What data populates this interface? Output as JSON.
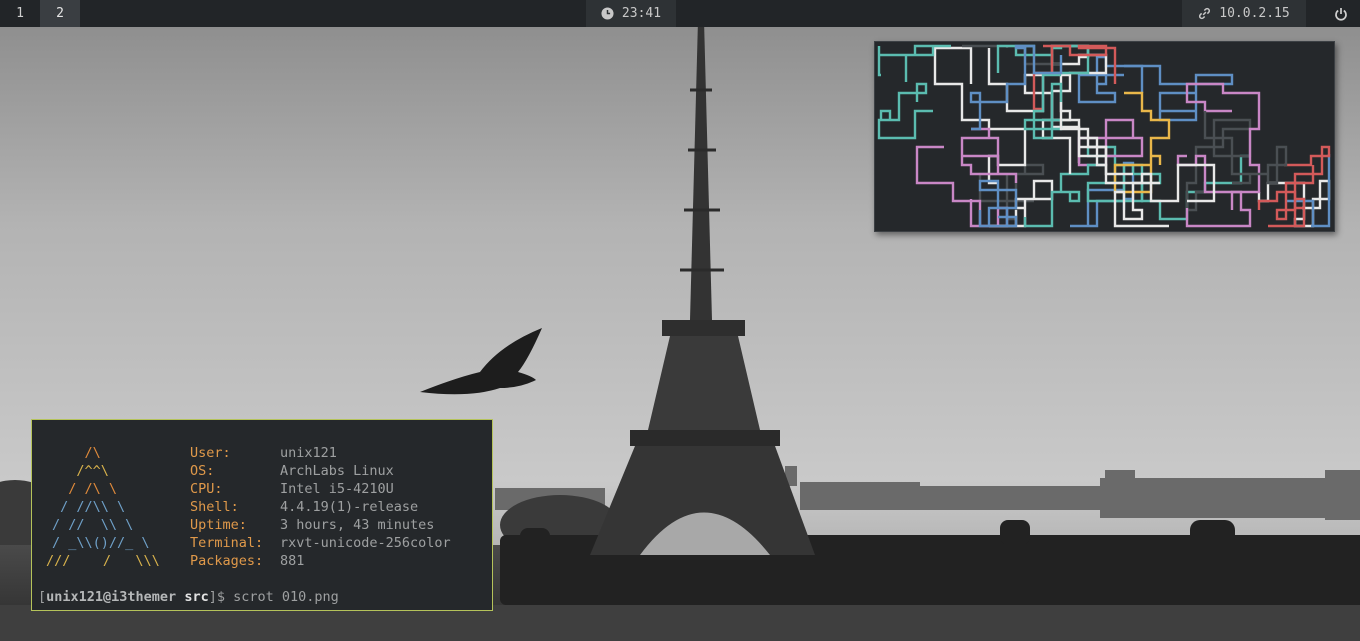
{
  "topbar": {
    "workspaces": [
      {
        "label": "1",
        "active": false
      },
      {
        "label": "2",
        "active": true
      }
    ],
    "clock": {
      "icon": "clock-icon",
      "time": "23:41"
    },
    "network": {
      "icon": "link-icon",
      "ip": "10.0.2.15"
    },
    "power": {
      "icon": "power-icon"
    }
  },
  "terminal": {
    "logo_lines": [
      "    /\\",
      "   /^^\\",
      "  / /\\ \\",
      " / //\\\\ \\",
      "/ //  \\\\ \\",
      "/ _\\\\()//_ \\",
      "///    /   \\\\\\"
    ],
    "info": [
      {
        "key": "User:",
        "value": "unix121"
      },
      {
        "key": "OS:",
        "value": "ArchLabs Linux"
      },
      {
        "key": "CPU:",
        "value": "Intel i5-4210U"
      },
      {
        "key": "Shell:",
        "value": "4.4.19(1)-release"
      },
      {
        "key": "Uptime:",
        "value": "3 hours, 43 minutes"
      },
      {
        "key": "Terminal:",
        "value": "rxvt-unicode-256color"
      },
      {
        "key": "Packages:",
        "value": "881"
      }
    ],
    "prompt": {
      "open": "[",
      "user_host": "unix121@i3themer",
      "dir": "src",
      "close": "]$",
      "command": "scrot 010.png"
    }
  },
  "colors": {
    "bar_bg": "#222528",
    "term_bg": "#25282b",
    "term_border": "#b5c35a",
    "accent_orange": "#e0994a",
    "pipe_colors": [
      "#e9b74a",
      "#d35a5a",
      "#5bbcb0",
      "#5f8fc4",
      "#c987c6",
      "#e8e8e8",
      "#4a4f53"
    ]
  }
}
